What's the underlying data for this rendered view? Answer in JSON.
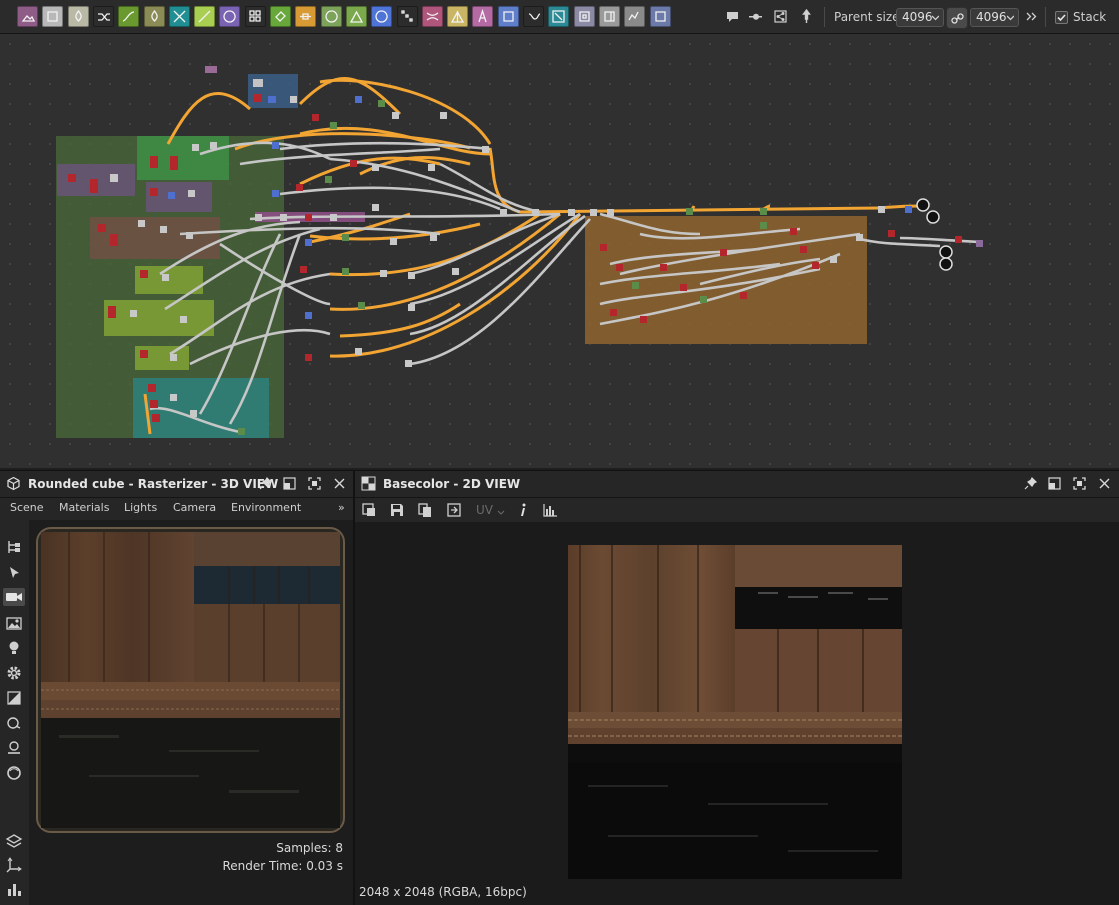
{
  "toolbar": {
    "node_buttons": [
      {
        "icon": "image-icon",
        "color": "#8e5c87"
      },
      {
        "icon": "uniform-color-icon",
        "color": "#b8b8b8"
      },
      {
        "icon": "levels-icon",
        "color": "#b9b9a6"
      },
      {
        "icon": "shuffle-icon",
        "color": "#2c2c2c"
      },
      {
        "icon": "curve-icon",
        "color": "#6a9a2f"
      },
      {
        "icon": "water-drop-icon",
        "color": "#8b8b55"
      },
      {
        "icon": "warp-icon",
        "color": "#1f8f93"
      },
      {
        "icon": "gradient-map-icon",
        "color": "#a9cf52"
      },
      {
        "icon": "shape-icon",
        "color": "#7b63b3"
      },
      {
        "icon": "tile-grid-icon",
        "color": "#2c2c2c"
      },
      {
        "icon": "paint-bucket-icon",
        "color": "#68a73a"
      },
      {
        "icon": "blend-icon",
        "color": "#d89a35"
      },
      {
        "icon": "sphere-icon",
        "color": "#7da25a"
      },
      {
        "icon": "histogram-icon",
        "color": "#7aa84a"
      },
      {
        "icon": "color-wheel-icon",
        "color": "#4f74d8"
      },
      {
        "icon": "noise-icon",
        "color": "#2c2c2c"
      },
      {
        "icon": "transform-icon",
        "color": "#b0567d"
      },
      {
        "icon": "triangle-mirror-icon",
        "color": "#c9b564"
      },
      {
        "icon": "text-icon",
        "color": "#b46aa3"
      },
      {
        "icon": "crop-icon",
        "color": "#5f7fcb"
      },
      {
        "icon": "value-switch-icon",
        "color": "#2c2c2c"
      },
      {
        "icon": "fx-map-icon",
        "color": "#2c8a96"
      },
      {
        "icon": "input-icon",
        "color": "#8a8aa4"
      },
      {
        "icon": "output-icon",
        "color": "#9a9a9a"
      },
      {
        "icon": "graph-icon",
        "color": "#8a8a8a"
      },
      {
        "icon": "frame-icon",
        "color": "#6b7aa8"
      }
    ],
    "extra_buttons": [
      "comment-icon",
      "slider-icon",
      "share-icon",
      "pin-icon"
    ],
    "parent_size_label": "Parent size:",
    "parent_size_value": "4096",
    "link_icon": "link-icon",
    "linked_size_value": "4096",
    "more_icon": "double-chevron-icon",
    "stack_label": "Stack"
  },
  "graph": {
    "name": "node-graph",
    "wire_colors": {
      "orange": "#f2a533",
      "gray": "#c8c8c8"
    }
  },
  "view3d": {
    "title": "Rounded cube - Rasterizer - 3D VIEW",
    "menu": [
      "Scene",
      "Materials",
      "Lights",
      "Camera",
      "Environment"
    ],
    "more": "»",
    "samples": "Samples: 8",
    "render_time": "Render Time: 0.03 s",
    "tools": [
      "hierarchy-icon",
      "pointer-icon",
      "camera-icon",
      "environment-icon",
      "light-icon",
      "settings-icon",
      "material-icon",
      "shape-icon",
      "ground-icon",
      "sphere-icon",
      "layers-icon",
      "axis-icon",
      "stats-icon"
    ]
  },
  "view2d": {
    "title": "Basecolor - 2D VIEW",
    "uv_label": "UV",
    "status": "2048 x 2048 (RGBA, 16bpc)"
  }
}
